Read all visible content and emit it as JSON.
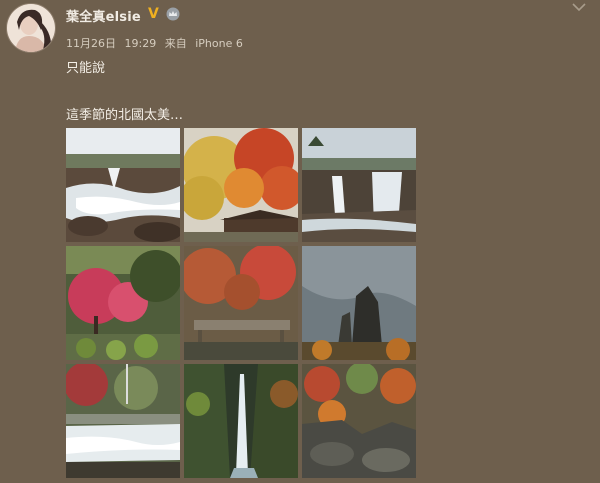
{
  "post": {
    "author": "葉全真elsie",
    "verified_badge": "V",
    "date": "11月26日",
    "time": "19:29",
    "source_prefix": "来自",
    "device": "iPhone 6",
    "text_line1": "只能說",
    "text_line2": "這季節的北國太美…",
    "photos": [
      {
        "icon": "waterfall-rocks-photo"
      },
      {
        "icon": "autumn-trees-photo"
      },
      {
        "icon": "waterfall-cliff-photo"
      },
      {
        "icon": "red-maple-garden-photo"
      },
      {
        "icon": "autumn-bridge-photo"
      },
      {
        "icon": "rock-mountain-photo"
      },
      {
        "icon": "river-rapids-photo"
      },
      {
        "icon": "gorge-waterfall-photo"
      },
      {
        "icon": "autumn-rocks-photo"
      }
    ]
  },
  "colors": {
    "background": "#6e5f4d",
    "verified": "#f0b020",
    "text": "#f4efe7"
  }
}
